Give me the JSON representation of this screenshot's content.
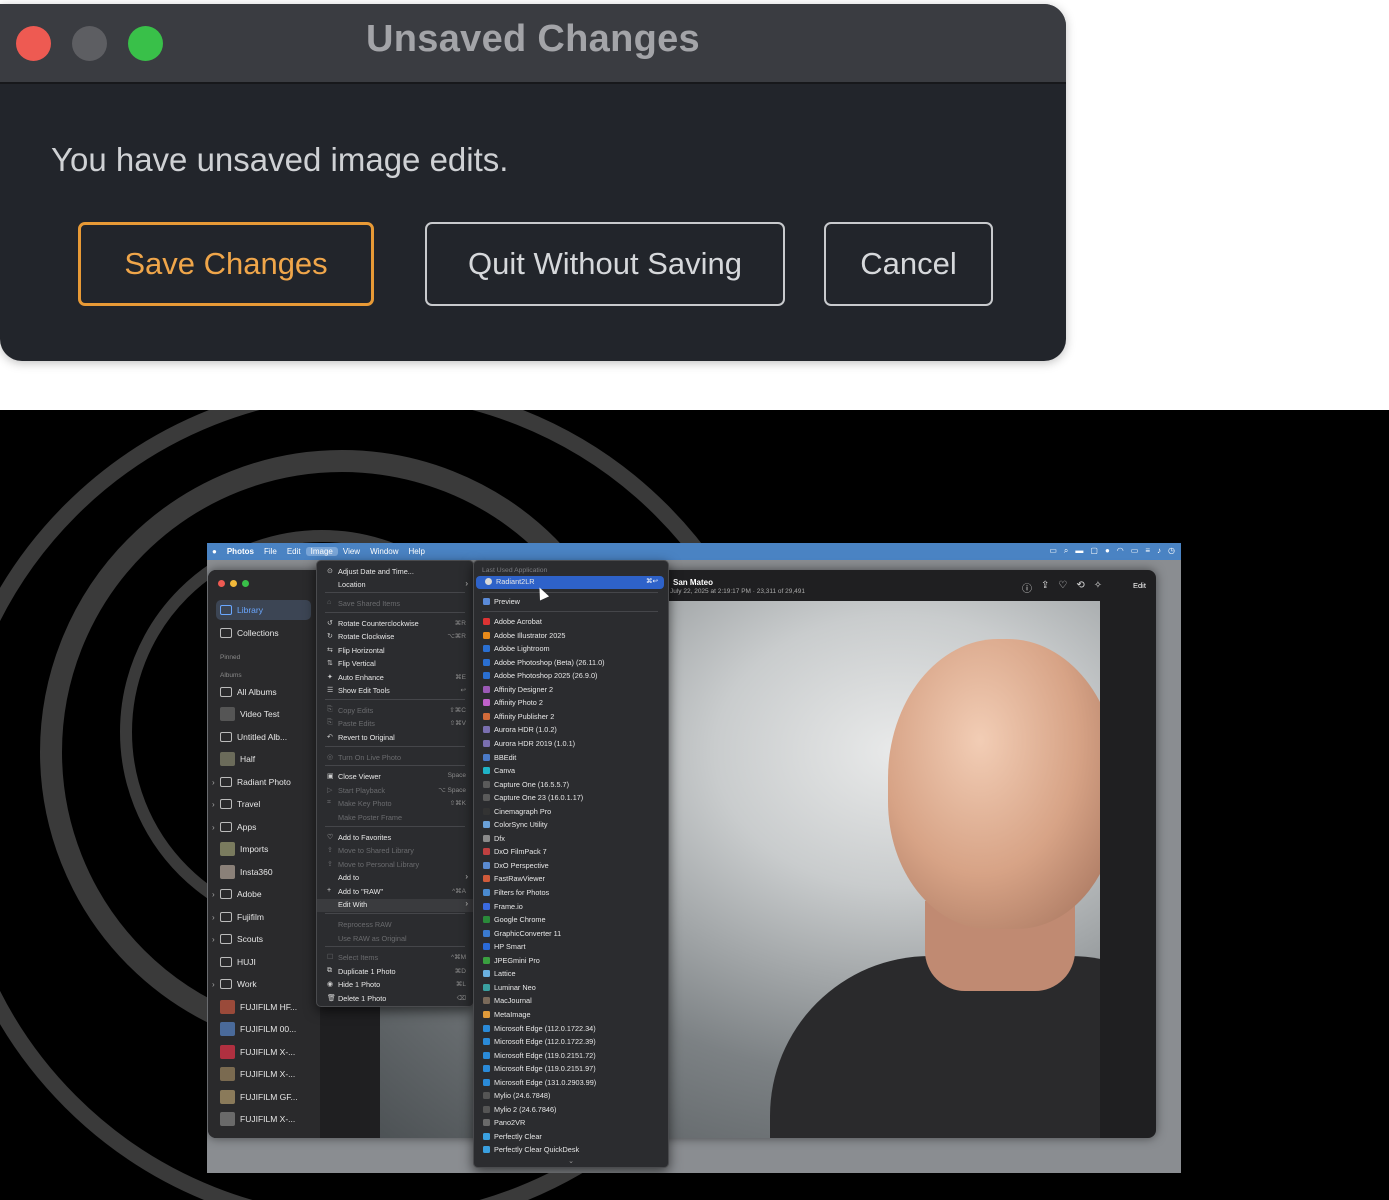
{
  "dialog": {
    "title": "Unsaved Changes",
    "message": "You have unsaved image edits.",
    "buttons": {
      "save": "Save Changes",
      "quit": "Quit Without Saving",
      "cancel": "Cancel"
    },
    "colors": {
      "accent": "#e89a36",
      "background": "#22252b"
    }
  },
  "menubar": {
    "apple": "",
    "items": [
      "Photos",
      "File",
      "Edit",
      "Image",
      "View",
      "Window",
      "Help"
    ]
  },
  "sidebar": {
    "library": "Library",
    "collections": "Collections",
    "pinned": "Pinned",
    "albums_header": "Albums",
    "items": [
      "All Albums",
      "Video Test",
      "Untitled Alb...",
      "Half",
      "Radiant Photo",
      "Travel",
      "Apps",
      "Imports",
      "Insta360",
      "Adobe",
      "Fujifilm",
      "Scouts",
      "HUJI",
      "Work",
      "FUJIFILM HF...",
      "FUJIFILM 00...",
      "FUJIFILM X-...",
      "FUJIFILM X-...",
      "FUJIFILM GF...",
      "FUJIFILM X-..."
    ]
  },
  "viewer": {
    "title": "San Mateo",
    "subtitle": "July 22, 2025 at 2:19:17 PM · 23,311 of 29,491",
    "edit": "Edit"
  },
  "image_menu": [
    {
      "label": "Adjust Date and Time...",
      "shortcut": "",
      "disabled": false
    },
    {
      "label": "Location",
      "shortcut": "›",
      "disabled": false
    },
    {
      "label": "Save Shared Items",
      "shortcut": "",
      "disabled": true
    },
    {
      "label": "Rotate Counterclockwise",
      "shortcut": "⌘R",
      "disabled": false
    },
    {
      "label": "Rotate Clockwise",
      "shortcut": "⌥⌘R",
      "disabled": false
    },
    {
      "label": "Flip Horizontal",
      "shortcut": "",
      "disabled": false
    },
    {
      "label": "Flip Vertical",
      "shortcut": "",
      "disabled": false
    },
    {
      "label": "Auto Enhance",
      "shortcut": "⌘E",
      "disabled": false
    },
    {
      "label": "Show Edit Tools",
      "shortcut": "↩",
      "disabled": false
    },
    {
      "label": "Copy Edits",
      "shortcut": "⇧⌘C",
      "disabled": true
    },
    {
      "label": "Paste Edits",
      "shortcut": "⇧⌘V",
      "disabled": true
    },
    {
      "label": "Revert to Original",
      "shortcut": "",
      "disabled": false
    },
    {
      "label": "Turn On Live Photo",
      "shortcut": "",
      "disabled": true
    },
    {
      "label": "Close Viewer",
      "shortcut": "Space",
      "disabled": false
    },
    {
      "label": "Start Playback",
      "shortcut": "⌥ Space",
      "disabled": true
    },
    {
      "label": "Make Key Photo",
      "shortcut": "⇧⌘K",
      "disabled": true
    },
    {
      "label": "Make Poster Frame",
      "shortcut": "",
      "disabled": true
    },
    {
      "label": "Add to Favorites",
      "shortcut": "",
      "disabled": false
    },
    {
      "label": "Move to Shared Library",
      "shortcut": "",
      "disabled": true
    },
    {
      "label": "Move to Personal Library",
      "shortcut": "",
      "disabled": true
    },
    {
      "label": "Add to",
      "shortcut": "›",
      "disabled": false
    },
    {
      "label": "Add to \"RAW\"",
      "shortcut": "^⌘A",
      "disabled": false
    },
    {
      "label": "Edit With",
      "shortcut": "›",
      "disabled": false
    },
    {
      "label": "Reprocess RAW",
      "shortcut": "",
      "disabled": true
    },
    {
      "label": "Use RAW as Original",
      "shortcut": "",
      "disabled": true
    },
    {
      "label": "Select Items",
      "shortcut": "^⌘M",
      "disabled": true
    },
    {
      "label": "Duplicate 1 Photo",
      "shortcut": "⌘D",
      "disabled": false
    },
    {
      "label": "Hide 1 Photo",
      "shortcut": "⌘L",
      "disabled": false
    },
    {
      "label": "Delete 1 Photo",
      "shortcut": "⌫",
      "disabled": false
    }
  ],
  "edit_with": {
    "header": "Last Used Application",
    "last_used": {
      "label": "Radiant2LR",
      "shortcut": "⌘↩"
    },
    "preview": "Preview",
    "apps": [
      "Adobe Acrobat",
      "Adobe Illustrator 2025",
      "Adobe Lightroom",
      "Adobe Photoshop (Beta) (26.11.0)",
      "Adobe Photoshop 2025 (26.9.0)",
      "Affinity Designer 2",
      "Affinity Photo 2",
      "Affinity Publisher 2",
      "Aurora HDR (1.0.2)",
      "Aurora HDR 2019 (1.0.1)",
      "BBEdit",
      "Canva",
      "Capture One (16.5.5.7)",
      "Capture One 23 (16.0.1.17)",
      "Cinemagraph Pro",
      "ColorSync Utility",
      "Dfx",
      "DxO FilmPack 7",
      "DxO Perspective",
      "FastRawViewer",
      "Filters for Photos",
      "Frame.io",
      "Google Chrome",
      "GraphicConverter 11",
      "HP Smart",
      "JPEGmini Pro",
      "Lattice",
      "Luminar Neo",
      "MacJournal",
      "MetaImage",
      "Microsoft Edge (112.0.1722.34)",
      "Microsoft Edge (112.0.1722.39)",
      "Microsoft Edge (119.0.2151.72)",
      "Microsoft Edge (119.0.2151.97)",
      "Microsoft Edge (131.0.2903.99)",
      "Mylio (24.6.7848)",
      "Mylio 2 (24.6.7846)",
      "Pano2VR",
      "Perfectly Clear",
      "Perfectly Clear QuickDesk"
    ],
    "more": "⌄"
  }
}
